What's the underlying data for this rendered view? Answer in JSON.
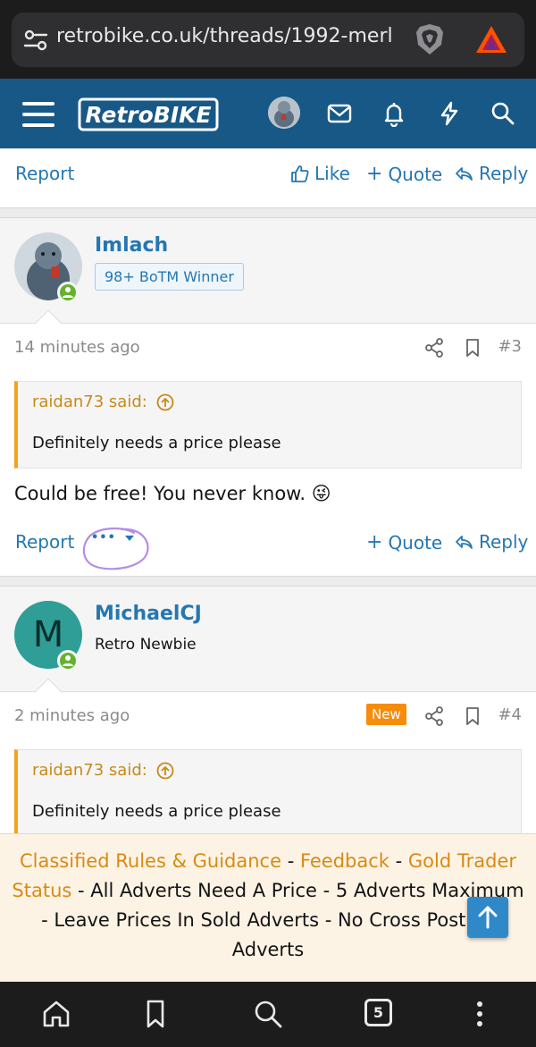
{
  "browser": {
    "url": "retrobike.co.uk/threads/1992-merl",
    "tab_count": "5"
  },
  "site": {
    "logo_text": "RetroBIKE"
  },
  "post_prev_actions": {
    "report": "Report",
    "like": "Like",
    "quote": "Quote",
    "reply": "Reply"
  },
  "posts": [
    {
      "username": "Imlach",
      "user_title": "98+ BoTM Winner",
      "time": "14 minutes ago",
      "number": "#3",
      "quote_author": "raidan73 said:",
      "quote_text": "Definitely needs a price please",
      "message": "Could be free! You never know. 😜",
      "actions": {
        "report": "Report",
        "more": "•••",
        "quote": "Quote",
        "reply": "Reply"
      }
    },
    {
      "username": "MichaelCJ",
      "avatar_letter": "M",
      "user_title": "Retro Newbie",
      "time": "2 minutes ago",
      "new_badge": "New",
      "number": "#4",
      "quote_author": "raidan73 said:",
      "quote_text": "Definitely needs a price please"
    }
  ],
  "notice": {
    "classified_rules": "Classified Rules & Guidance",
    "sep1": " - ",
    "feedback": "Feedback",
    "sep2": " - ",
    "gold_trader_status": "Gold Trader Status",
    "rest": " - All Adverts Need A Price - 5 Adverts Maximum - Leave Prices In Sold Adverts - No Cross Posting Adverts"
  },
  "colors": {
    "header_bg": "#185886",
    "link": "#2577b1",
    "online": "#63b32e",
    "quote_accent": "#f3a21e",
    "new_badge": "#f78c0c",
    "notice_bg": "#fdf3e5",
    "annotation": "#b48ce6"
  }
}
